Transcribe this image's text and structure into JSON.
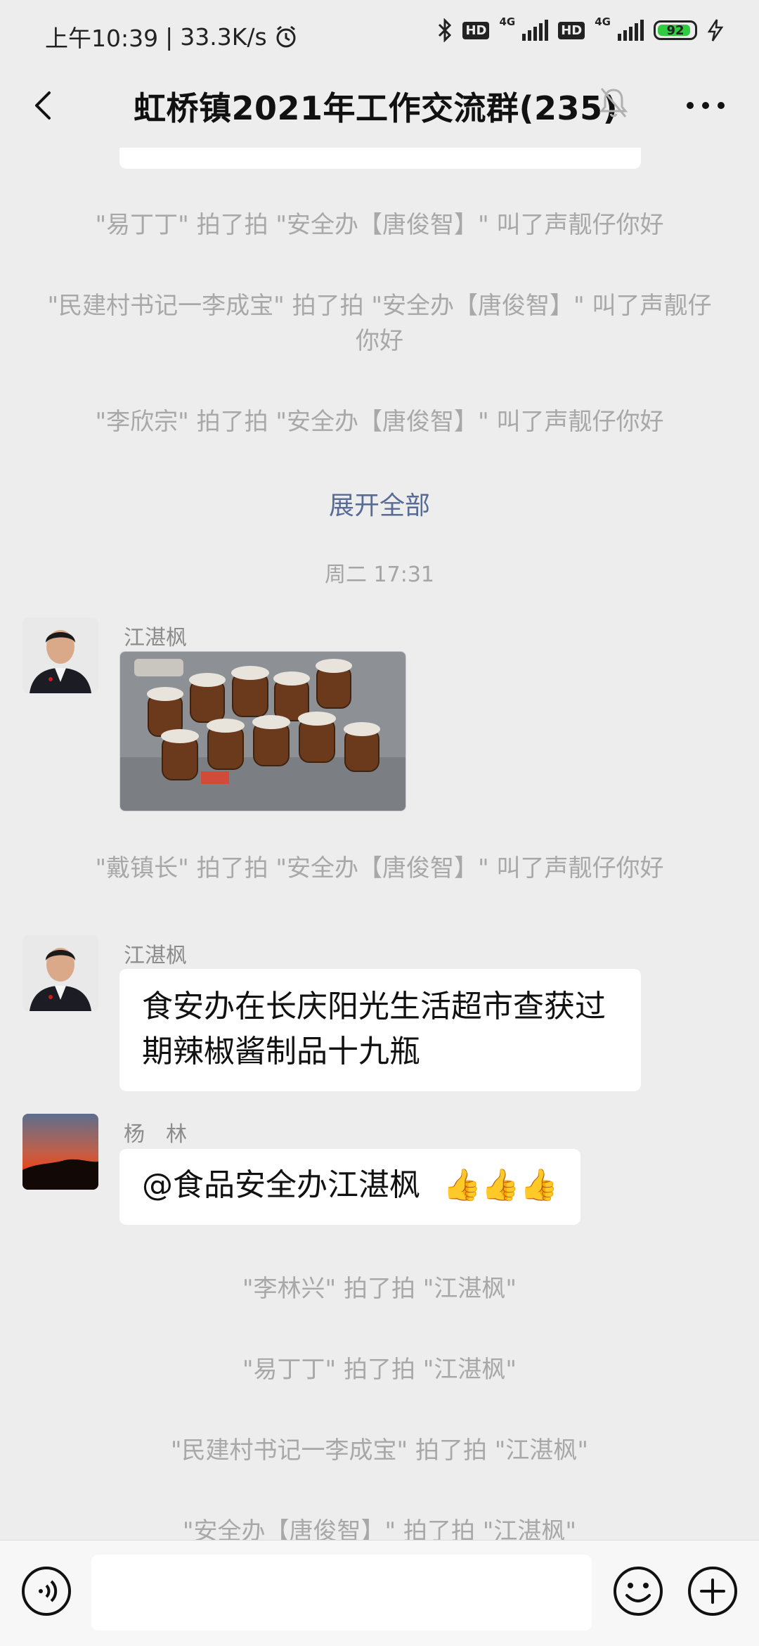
{
  "status_bar": {
    "time": "上午10:39",
    "speed": "33.3K/s",
    "hd1": "HD",
    "hd2": "HD",
    "net1": "4G",
    "net2": "4G",
    "battery": "92",
    "icons": [
      "alarm-icon",
      "bluetooth-icon",
      "signal-icon",
      "battery-icon",
      "charging-icon"
    ]
  },
  "header": {
    "title": "虹桥镇2021年工作交流群(235)",
    "icons": [
      "back-icon",
      "mute-icon",
      "more-icon"
    ]
  },
  "messages": {
    "sys1": "\"易丁丁\" 拍了拍 \"安全办【唐俊智】\" 叫了声靓仔你好",
    "sys2": "\"民建村书记一李成宝\" 拍了拍 \"安全办【唐俊智】\" 叫了声靓仔你好",
    "sys3": "\"李欣宗\" 拍了拍 \"安全办【唐俊智】\" 叫了声靓仔你好",
    "expand": "展开全部",
    "time": "周二 17:31",
    "msg1_sender": "江湛枫",
    "sys4": "\"戴镇长\" 拍了拍 \"安全办【唐俊智】\" 叫了声靓仔你好",
    "msg2_sender": "江湛枫",
    "msg2_text": "食安办在长庆阳光生活超市查获过期辣椒酱制品十九瓶",
    "msg3_sender": "杨　林",
    "msg3_text": "@食品安全办江湛枫",
    "msg3_emoji": "👍👍👍",
    "sys5": "\"李林兴\" 拍了拍 \"江湛枫\"",
    "sys6": "\"易丁丁\" 拍了拍 \"江湛枫\"",
    "sys7": "\"民建村书记一李成宝\" 拍了拍 \"江湛枫\"",
    "sys8": "\"安全办【唐俊智】\" 拍了拍 \"江湛枫\""
  },
  "input_bar": {
    "icons": [
      "voice-icon",
      "emoji-icon",
      "add-icon"
    ]
  },
  "colors": {
    "background": "#ededed",
    "link": "#576b95",
    "system_text": "#a8a8a8",
    "bubble": "#ffffff"
  }
}
